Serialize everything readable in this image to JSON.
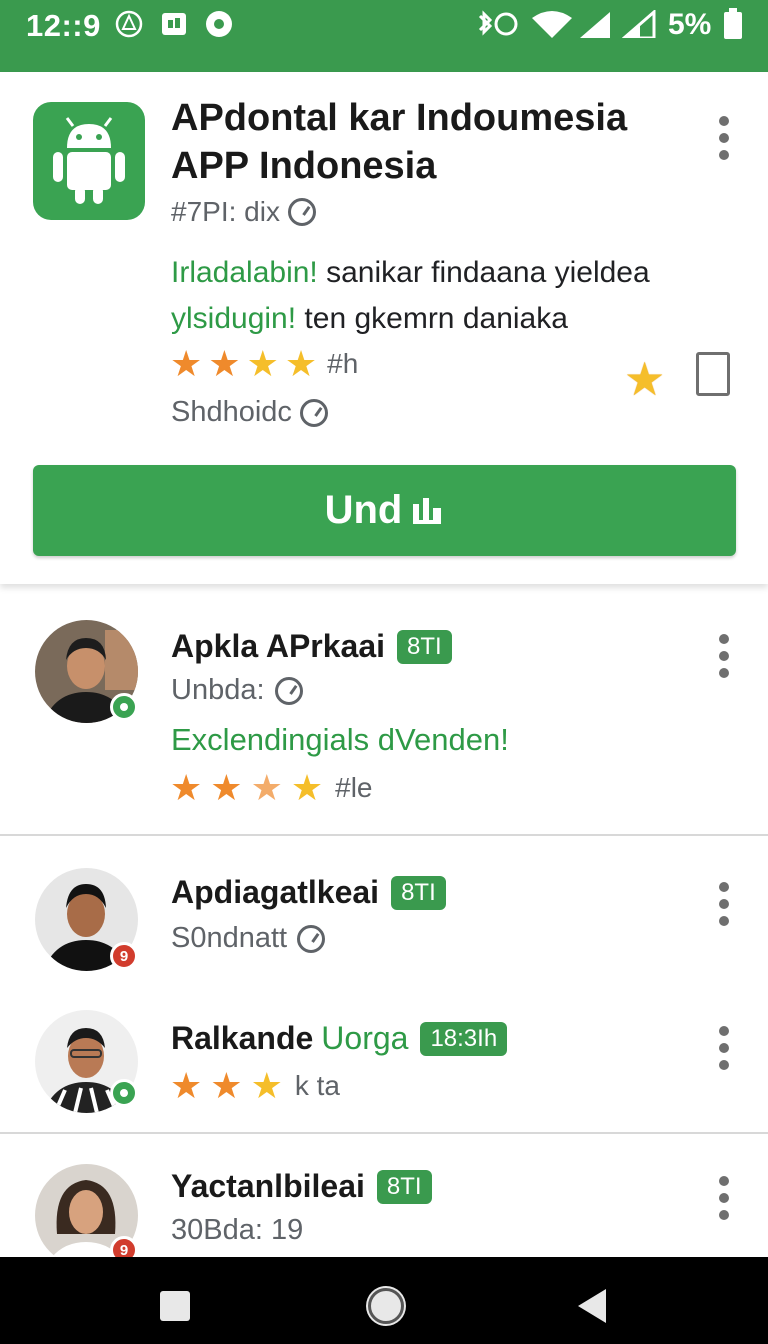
{
  "status_bar": {
    "time": "12::9",
    "battery": "5%",
    "background": "#3a9a4e"
  },
  "app": {
    "title": "APdontal kar Indoumesia APP Indonesia",
    "subtitle": "#7PI: dix",
    "description_highlight_1": "Irladalabin!",
    "description_rest_1": "sanikar findaana yieldea",
    "description_highlight_2": "ylsidugin!",
    "description_rest_2": "ten gkemrn daniaka",
    "rating_text": "#h",
    "status": "Shdhoidc",
    "install_label": "Und",
    "icon": "android-robot-icon",
    "accent": "#3aa352"
  },
  "reviews": [
    {
      "name": "Apkla APrkaai",
      "tag": "8TI",
      "sub": "Unbda:",
      "text": "Exclendingials dVenden!",
      "rating_text": "#le",
      "badge": ""
    },
    {
      "name": "Apdiagatlkeai",
      "tag": "8TI",
      "sub": "S0ndnatt",
      "badge": "9"
    },
    {
      "name_prefix": "Ralkande",
      "name_highlight": "Uorga",
      "tag": "18:3Ih",
      "rating_text": "k ta",
      "badge": ""
    },
    {
      "name": "Yactanlbileai",
      "tag": "8TI",
      "sub": "30Bda: 19",
      "badge": "9"
    }
  ]
}
